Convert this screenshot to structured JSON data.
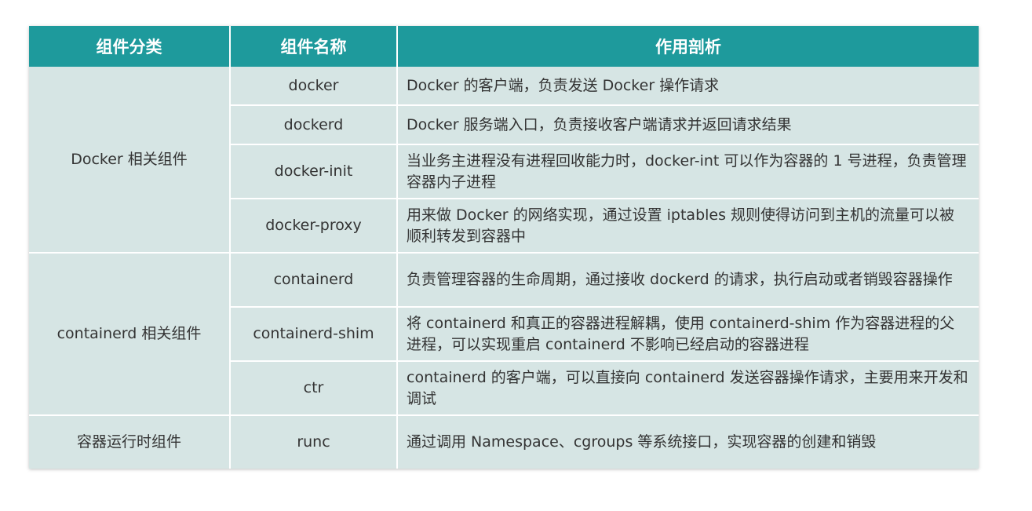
{
  "table": {
    "headers": [
      "组件分类",
      "组件名称",
      "作用剖析"
    ],
    "groups": [
      {
        "category": "Docker 相关组件",
        "rows": [
          {
            "name": "docker",
            "description": "Docker 的客户端，负责发送 Docker 操作请求"
          },
          {
            "name": "dockerd",
            "description": "Docker 服务端入口，负责接收客户端请求并返回请求结果"
          },
          {
            "name": "docker-init",
            "description": "当业务主进程没有进程回收能力时，docker-int 可以作为容器的 1 号进程，负责管理容器内子进程"
          },
          {
            "name": "docker-proxy",
            "description": "用来做 Docker 的网络实现，通过设置 iptables 规则使得访问到主机的流量可以被顺利转发到容器中"
          }
        ]
      },
      {
        "category": "containerd 相关组件",
        "rows": [
          {
            "name": "containerd",
            "description": "负责管理容器的生命周期，通过接收 dockerd 的请求，执行启动或者销毁容器操作"
          },
          {
            "name": "containerd-shim",
            "description": "将 containerd 和真正的容器进程解耦，使用 containerd-shim 作为容器进程的父进程，可以实现重启 containerd 不影响已经启动的容器进程"
          },
          {
            "name": "ctr",
            "description": "containerd 的客户端，可以直接向 containerd 发送容器操作请求，主要用来开发和调试"
          }
        ]
      },
      {
        "category": "容器运行时组件",
        "rows": [
          {
            "name": "runc",
            "description": "通过调用 Namespace、cgroups 等系统接口，实现容器的创建和销毁"
          }
        ]
      }
    ]
  },
  "colors": {
    "header_bg": "#1e9a9c",
    "header_text": "#ffffff",
    "cell_bg": "#d6e5e4",
    "cell_text": "#333333"
  }
}
